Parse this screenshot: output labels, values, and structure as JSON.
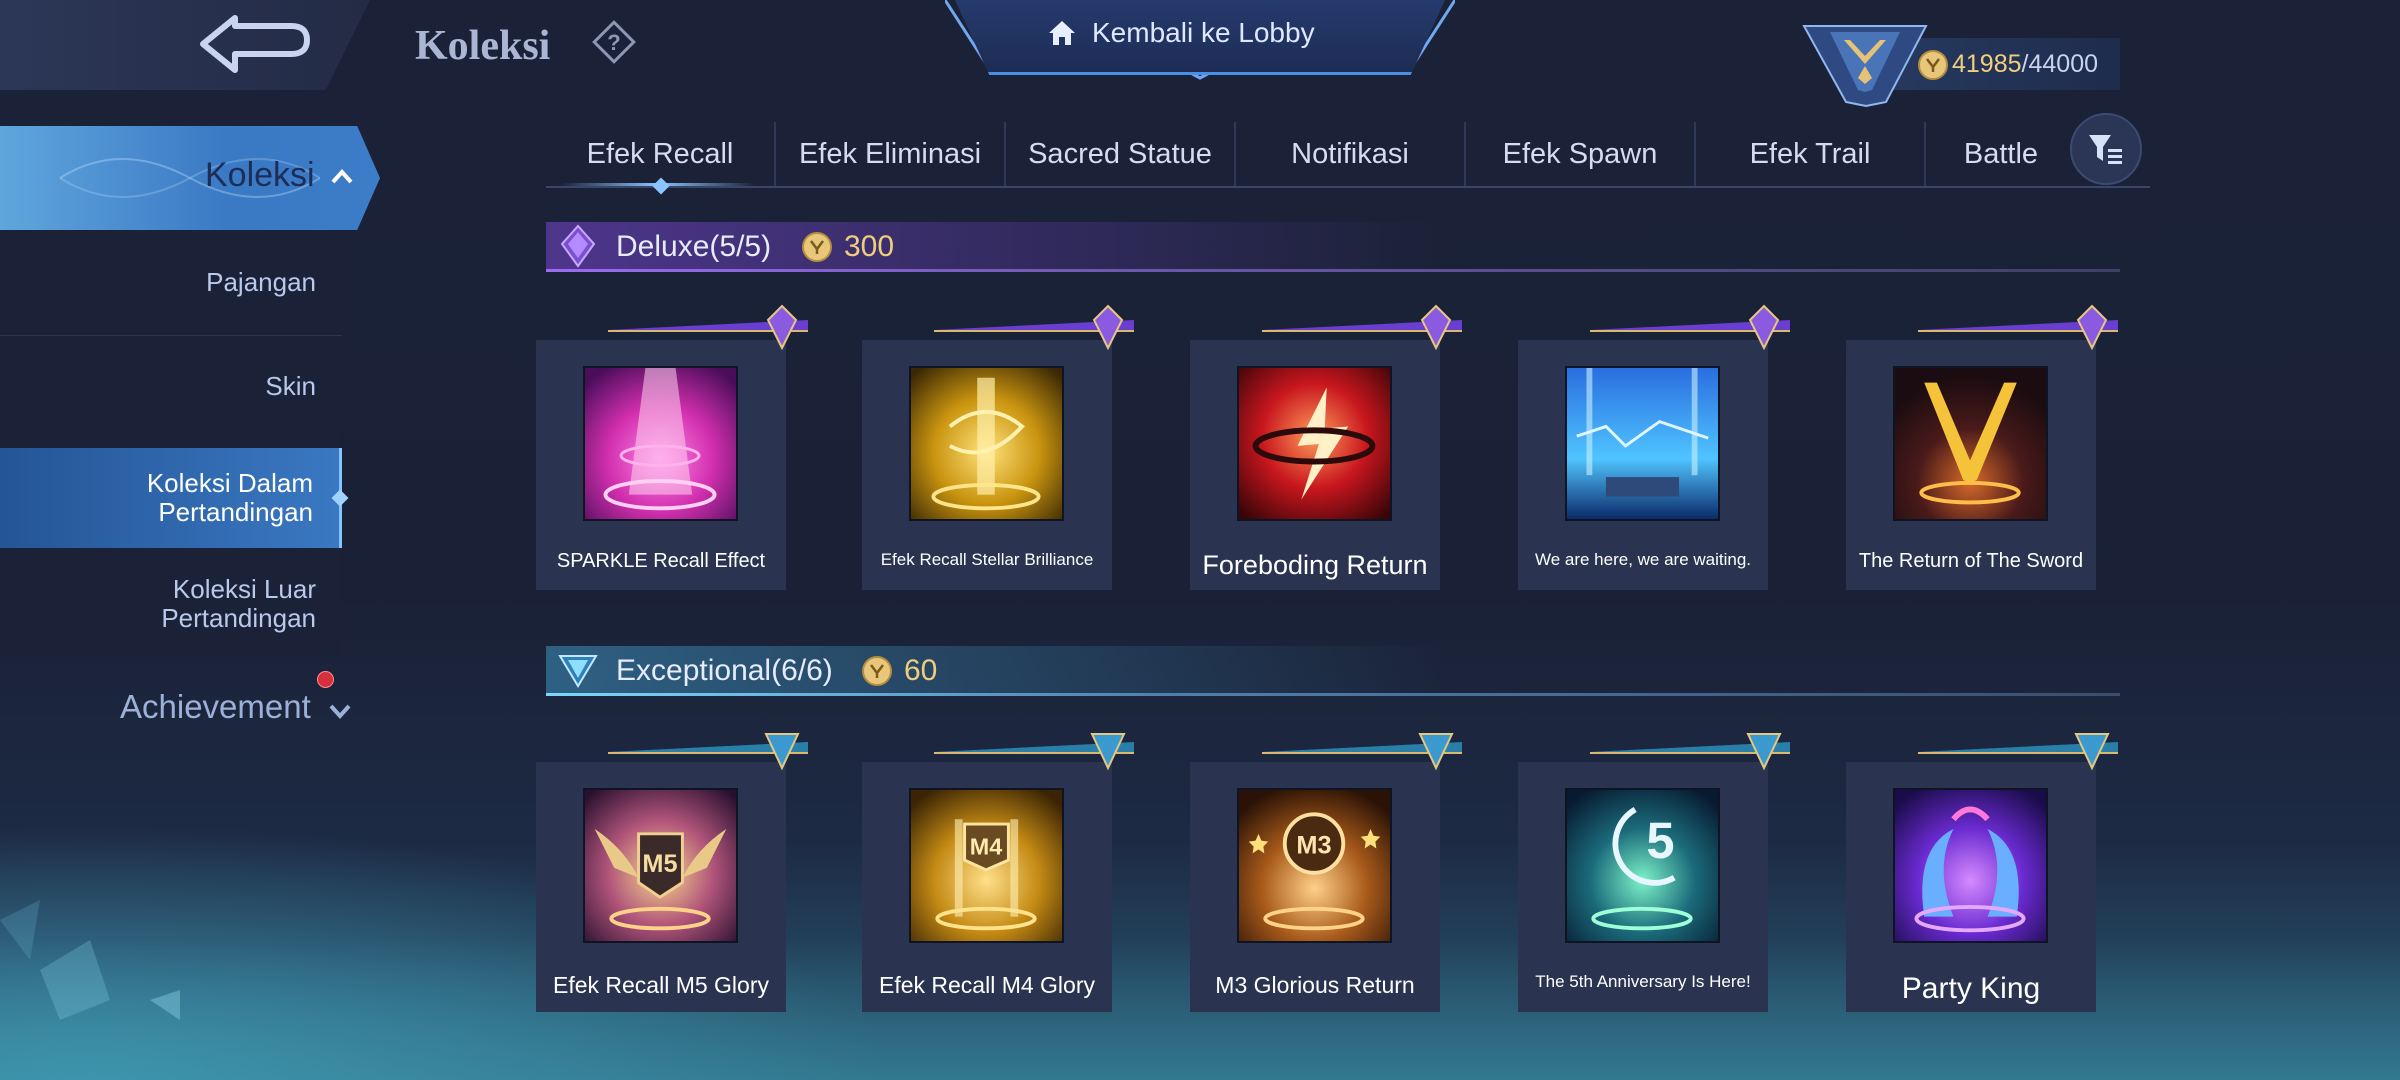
{
  "header": {
    "title": "Koleksi",
    "lobby_label": "Kembali ke Lobby",
    "currency_value": "41985",
    "currency_max": "/44000"
  },
  "sidebar": {
    "active_label": "Koleksi",
    "items": [
      {
        "label": "Pajangan"
      },
      {
        "label": "Skin"
      },
      {
        "label_line1": "Koleksi Dalam",
        "label_line2": "Pertandingan"
      },
      {
        "label_line1": "Koleksi Luar",
        "label_line2": "Pertandingan"
      }
    ],
    "achievement_label": "Achievement"
  },
  "tabs": [
    "Efek Recall",
    "Efek Eliminasi",
    "Sacred Statue",
    "Notifikasi",
    "Efek Spawn",
    "Efek Trail",
    "Battle"
  ],
  "sections": [
    {
      "title": "Deluxe",
      "count": "(5/5)",
      "price": "300",
      "accent": "#8a4dd8",
      "items": [
        {
          "name": "SPARKLE Recall Effect",
          "colors": [
            "#ff4fc8",
            "#7a1a8c"
          ]
        },
        {
          "name": "Efek Recall Stellar Brilliance",
          "colors": [
            "#f5c542",
            "#6b4a0a"
          ]
        },
        {
          "name": "Foreboding Return",
          "colors": [
            "#ff5a3c",
            "#6a0e14"
          ]
        },
        {
          "name": "We are here, we are waiting.",
          "colors": [
            "#4fd0ff",
            "#123a8a"
          ]
        },
        {
          "name": "The Return of The Sword",
          "colors": [
            "#f5b642",
            "#3a1a1a"
          ]
        }
      ]
    },
    {
      "title": "Exceptional",
      "count": "(6/6)",
      "price": "60",
      "accent": "#5cc6ee",
      "items": [
        {
          "name": "Efek Recall M5 Glory",
          "colors": [
            "#f7d07a",
            "#6a2a5a"
          ]
        },
        {
          "name": "Efek Recall M4 Glory",
          "colors": [
            "#ffcf4a",
            "#5a3a08"
          ]
        },
        {
          "name": "M3 Glorious Return",
          "colors": [
            "#ffc46a",
            "#5a2a0a"
          ]
        },
        {
          "name": "The 5th Anniversary Is Here!",
          "colors": [
            "#7cf2c8",
            "#0c3a54"
          ]
        },
        {
          "name": "Party King",
          "colors": [
            "#c46aff",
            "#2a1a7a"
          ]
        }
      ]
    }
  ],
  "colors": {
    "gold": "#f0cd7d",
    "accent_blue": "#3a79c4"
  }
}
